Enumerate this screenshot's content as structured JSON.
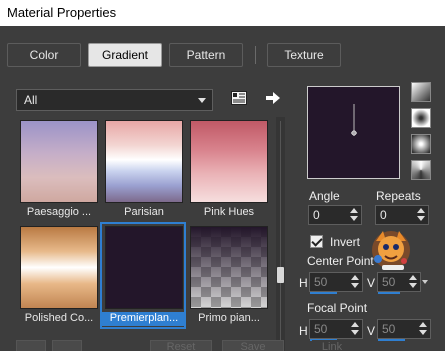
{
  "window": {
    "title": "Material Properties"
  },
  "tabs": [
    {
      "label": "Color"
    },
    {
      "label": "Gradient"
    },
    {
      "label": "Pattern"
    },
    {
      "label": "Texture"
    }
  ],
  "category_dropdown": {
    "value": "All"
  },
  "gallery": {
    "items": [
      {
        "label": "Paesaggio ...",
        "selected": false
      },
      {
        "label": "Parisian",
        "selected": false
      },
      {
        "label": "Pink Hues",
        "selected": false
      },
      {
        "label": "Polished Co...",
        "selected": false
      },
      {
        "label": "Premierplan...",
        "selected": true
      },
      {
        "label": "Primo pian...",
        "selected": false
      }
    ]
  },
  "angle": {
    "label": "Angle",
    "value": "0"
  },
  "repeats": {
    "label": "Repeats",
    "value": "0"
  },
  "invert": {
    "label": "Invert",
    "checked": true
  },
  "center_point": {
    "label": "Center Point",
    "h_label": "H",
    "h_value": "50",
    "v_label": "V",
    "v_value": "50"
  },
  "focal_point": {
    "label": "Focal Point",
    "h_label": "H",
    "h_value": "50",
    "v_label": "V",
    "v_value": "50"
  },
  "bottom": {
    "reset_label": "Reset",
    "save_label": "Save",
    "link_label": "Link"
  },
  "colors": {
    "accent": "#2f7fd1",
    "preview_fill": "#23162a"
  }
}
